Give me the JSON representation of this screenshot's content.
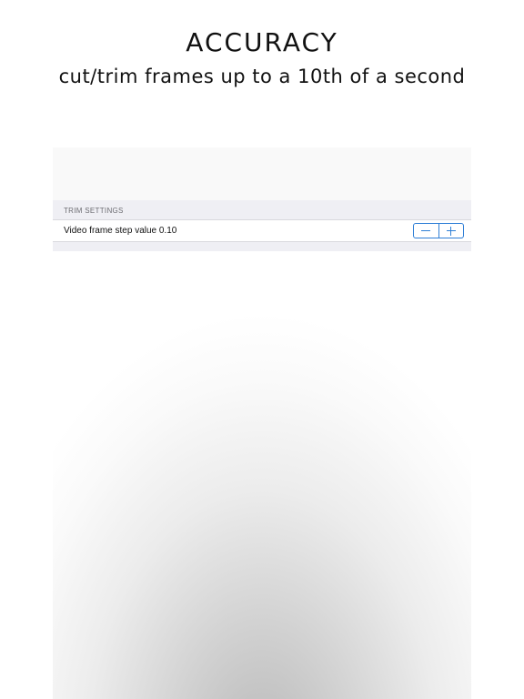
{
  "promo": {
    "title": "ACCURACY",
    "subtitle": "cut/trim frames up to a 10th of a second"
  },
  "settings": {
    "section_header": "TRIM SETTINGS",
    "rows": [
      {
        "label": "Video frame step value 0.10",
        "control": "stepper",
        "decrement_icon": "minus-icon",
        "increment_icon": "plus-icon"
      }
    ]
  },
  "colors": {
    "accent": "#2f7fd6",
    "section_background": "#efeff4",
    "header_text": "#6d6d72"
  }
}
